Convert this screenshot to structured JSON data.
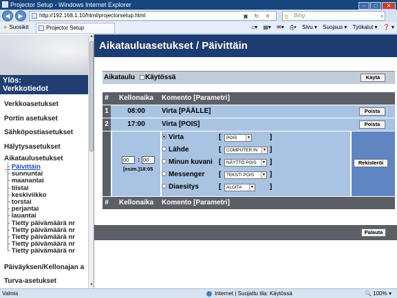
{
  "window": {
    "title": "Projector Setup - Windows Internet Explorer",
    "minimize": "–",
    "maximize": "□",
    "close": "✕"
  },
  "addressbar": {
    "back": "◀",
    "forward": "▶",
    "url": "http://192.168.1.10/html/projectorsetup.html",
    "compat_icon": "▣",
    "refresh_icon": "↻",
    "stop_icon": "✕",
    "search_placeholder": "Bing",
    "search_icon": "⌕"
  },
  "favorites": {
    "label": "Suosikit",
    "tab_title": "Projector Setup",
    "commands": [
      "Sivu ▾",
      "Suojaus ▾",
      "Työkalut ▾",
      "❓ ▾"
    ]
  },
  "sidebar": {
    "up_label": "Ylös:\nVerkkotiedot",
    "items_top": [
      "Verkkoasetukset",
      "Portin asetukset",
      "Sähköpostiasetukset",
      "Hälytysasetukset",
      "Aikataulusetukset"
    ],
    "sub_items": [
      {
        "label": "Päivittäin",
        "active": true
      },
      {
        "label": "sunnuntai",
        "active": false
      },
      {
        "label": "maanantai",
        "active": false
      },
      {
        "label": "tiistai",
        "active": false
      },
      {
        "label": "keskiviikko",
        "active": false
      },
      {
        "label": "torstai",
        "active": false
      },
      {
        "label": "perjantai",
        "active": false
      },
      {
        "label": "lauantai",
        "active": false
      },
      {
        "label": "Tietty päivämäärä nr",
        "active": false
      },
      {
        "label": "Tietty päivämäärä nr",
        "active": false
      },
      {
        "label": "Tietty päivämäärä nr",
        "active": false
      },
      {
        "label": "Tietty päivämäärä nr",
        "active": false
      },
      {
        "label": "Tietty päivämäärä nr",
        "active": false
      }
    ],
    "items_bottom": [
      "Päiväyksen/Kellonajan a",
      "Turva-asetukset"
    ]
  },
  "main": {
    "title": "Aikatauluasetukset / Päivittäin",
    "schedule": {
      "label": "Aikataulu",
      "enabled_label": "Käytössä",
      "enabled": false,
      "apply_button": "Käytä"
    },
    "table": {
      "headers": {
        "num": "#",
        "time": "Kellonaika",
        "command": "Komento [Parametri]"
      },
      "rows": [
        {
          "num": "1",
          "time": "08:00",
          "command": "Virta [PÄÄLLE]",
          "delete_button": "Poista"
        },
        {
          "num": "2",
          "time": "17:00",
          "command": "Virta [POIS]",
          "delete_button": "Poista"
        }
      ],
      "editor": {
        "hour": "00",
        "separator": ":",
        "minute": "00",
        "example": "[esim.]18:05",
        "register_button": "Rekisteröi",
        "options": [
          {
            "label": "Virta",
            "value": "POIS",
            "selected": true
          },
          {
            "label": "Lähde",
            "value": "COMPUTER IN",
            "selected": false
          },
          {
            "label": "Minun kuvani",
            "value": "NÄYTTÖ POIS",
            "selected": false
          },
          {
            "label": "Messenger",
            "value": "TEKSTI POIS",
            "selected": false
          },
          {
            "label": "Diaesitys",
            "value": "ALOITA",
            "selected": false
          }
        ]
      }
    },
    "restore_button": "Palauta"
  },
  "statusbar": {
    "status": "Valmis",
    "zone": "Internet | Suojattu tila: Käytössä",
    "zoom": "100%"
  }
}
